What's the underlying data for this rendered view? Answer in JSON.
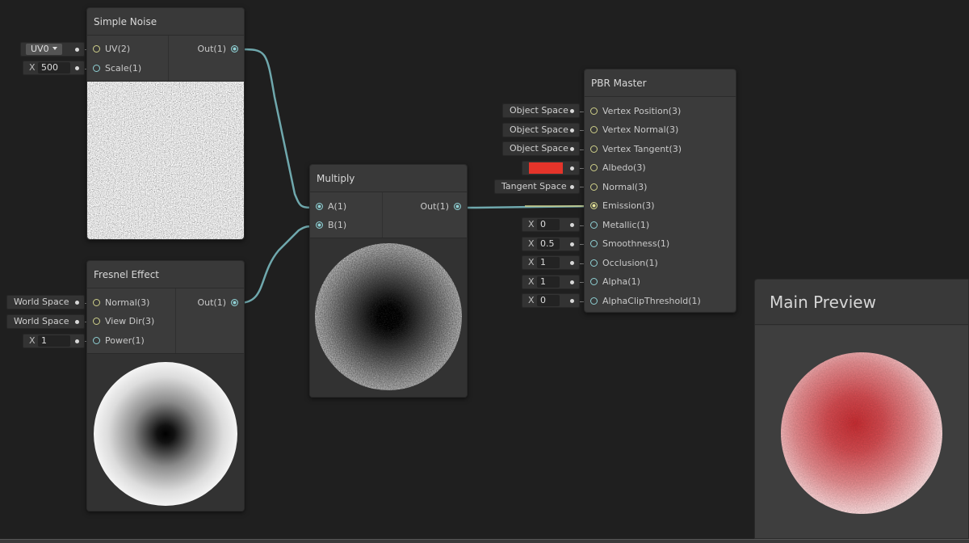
{
  "nodes": {
    "simple_noise": {
      "title": "Simple Noise",
      "inputs": [
        "UV(2)",
        "Scale(1)"
      ],
      "output": "Out(1)",
      "uv_dropdown": "UV0",
      "scale_axis": "X",
      "scale_value": "500"
    },
    "fresnel": {
      "title": "Fresnel Effect",
      "inputs": [
        "Normal(3)",
        "View Dir(3)",
        "Power(1)"
      ],
      "output": "Out(1)",
      "normal_space": "World Space",
      "viewdir_space": "World Space",
      "power_axis": "X",
      "power_value": "1"
    },
    "multiply": {
      "title": "Multiply",
      "inputs": [
        "A(1)",
        "B(1)"
      ],
      "output": "Out(1)"
    },
    "pbr_master": {
      "title": "PBR Master",
      "inputs": [
        "Vertex Position(3)",
        "Vertex Normal(3)",
        "Vertex Tangent(3)",
        "Albedo(3)",
        "Normal(3)",
        "Emission(3)",
        "Metallic(1)",
        "Smoothness(1)",
        "Occlusion(1)",
        "Alpha(1)",
        "AlphaClipThreshold(1)"
      ],
      "fields": {
        "vertex_position": "Object Space",
        "vertex_normal": "Object Space",
        "vertex_tangent": "Object Space",
        "albedo_color": "#e4342a",
        "normal": "Tangent Space",
        "metallic": "0",
        "smoothness": "0.5",
        "occlusion": "1",
        "alpha": "1",
        "alpha_clip": "0"
      },
      "axis_label": "X"
    }
  },
  "main_preview": {
    "title": "Main Preview"
  },
  "colors": {
    "background": "#1f1f1f",
    "node": "#393939",
    "wire": "#6fa8ad",
    "port_vec3": "#cfd08a",
    "port_vec1": "#8fd0d4",
    "albedo": "#e4342a"
  }
}
